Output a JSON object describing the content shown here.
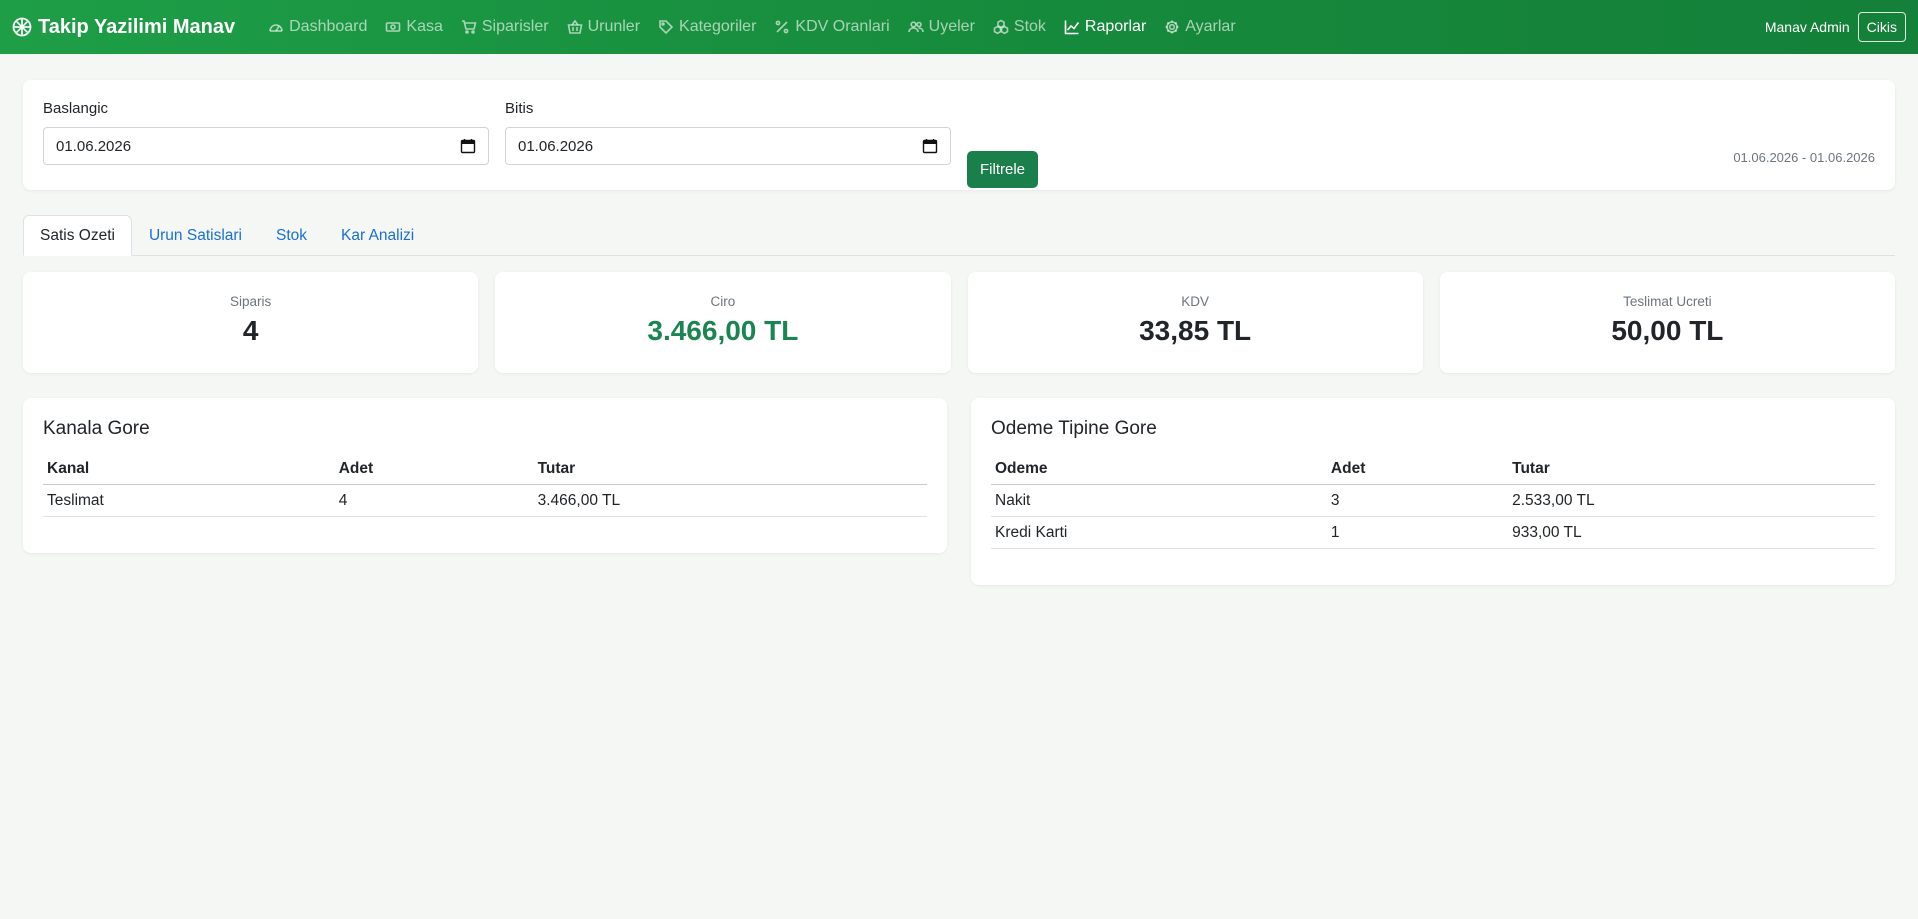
{
  "app": {
    "brand": "Takip Yazilimi Manav"
  },
  "nav": {
    "items": [
      {
        "label": "Dashboard",
        "icon": "gauge-icon"
      },
      {
        "label": "Kasa",
        "icon": "cash-icon"
      },
      {
        "label": "Siparisler",
        "icon": "cart-icon"
      },
      {
        "label": "Urunler",
        "icon": "basket-icon"
      },
      {
        "label": "Kategoriler",
        "icon": "tag-icon"
      },
      {
        "label": "KDV Oranlari",
        "icon": "percent-icon"
      },
      {
        "label": "Uyeler",
        "icon": "people-icon"
      },
      {
        "label": "Stok",
        "icon": "boxes-icon"
      },
      {
        "label": "Raporlar",
        "icon": "graph-icon"
      },
      {
        "label": "Ayarlar",
        "icon": "gear-icon"
      }
    ],
    "user": "Manav Admin",
    "logout": "Cikis"
  },
  "filter": {
    "start_label": "Baslangic",
    "start_value": "01.06.2026",
    "end_label": "Bitis",
    "end_value": "01.06.2026",
    "button": "Filtrele",
    "range_text": "01.06.2026 - 01.06.2026"
  },
  "tabs": [
    "Satis Ozeti",
    "Urun Satislari",
    "Stok",
    "Kar Analizi"
  ],
  "stats": [
    {
      "label": "Siparis",
      "value": "4"
    },
    {
      "label": "Ciro",
      "value": "3.466,00 TL"
    },
    {
      "label": "KDV",
      "value": "33,85 TL"
    },
    {
      "label": "Teslimat Ucreti",
      "value": "50,00 TL"
    }
  ],
  "channel_table": {
    "title": "Kanala Gore",
    "headers": [
      "Kanal",
      "Adet",
      "Tutar"
    ],
    "rows": [
      [
        "Teslimat",
        "4",
        "3.466,00 TL"
      ]
    ]
  },
  "payment_table": {
    "title": "Odeme Tipine Gore",
    "headers": [
      "Odeme",
      "Adet",
      "Tutar"
    ],
    "rows": [
      [
        "Nakit",
        "3",
        "2.533,00 TL"
      ],
      [
        "Kredi Karti",
        "1",
        "933,00 TL"
      ]
    ]
  },
  "colors": {
    "navbar": "#168a3c",
    "accent": "#1a7f4b",
    "link": "#1a6fd4",
    "ciro": "#1a8551"
  }
}
